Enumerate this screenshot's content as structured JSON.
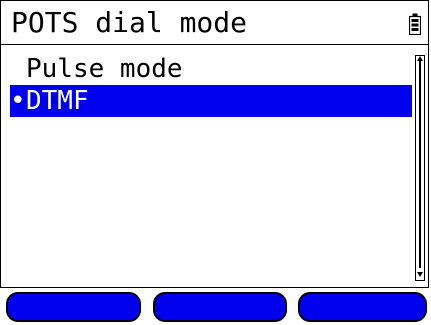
{
  "title": "POTS dial mode",
  "status": {
    "battery_icon": "battery-icon"
  },
  "menu": {
    "items": [
      {
        "label": "Pulse mode",
        "selected": false,
        "marker": ""
      },
      {
        "label": "DTMF",
        "selected": true,
        "marker": "•"
      }
    ]
  },
  "softkeys": [
    {
      "label": ""
    },
    {
      "label": ""
    },
    {
      "label": ""
    }
  ],
  "colors": {
    "selection": "#0000ee",
    "softkey": "#0000ee",
    "foreground": "#000000",
    "background": "#ffffff"
  }
}
